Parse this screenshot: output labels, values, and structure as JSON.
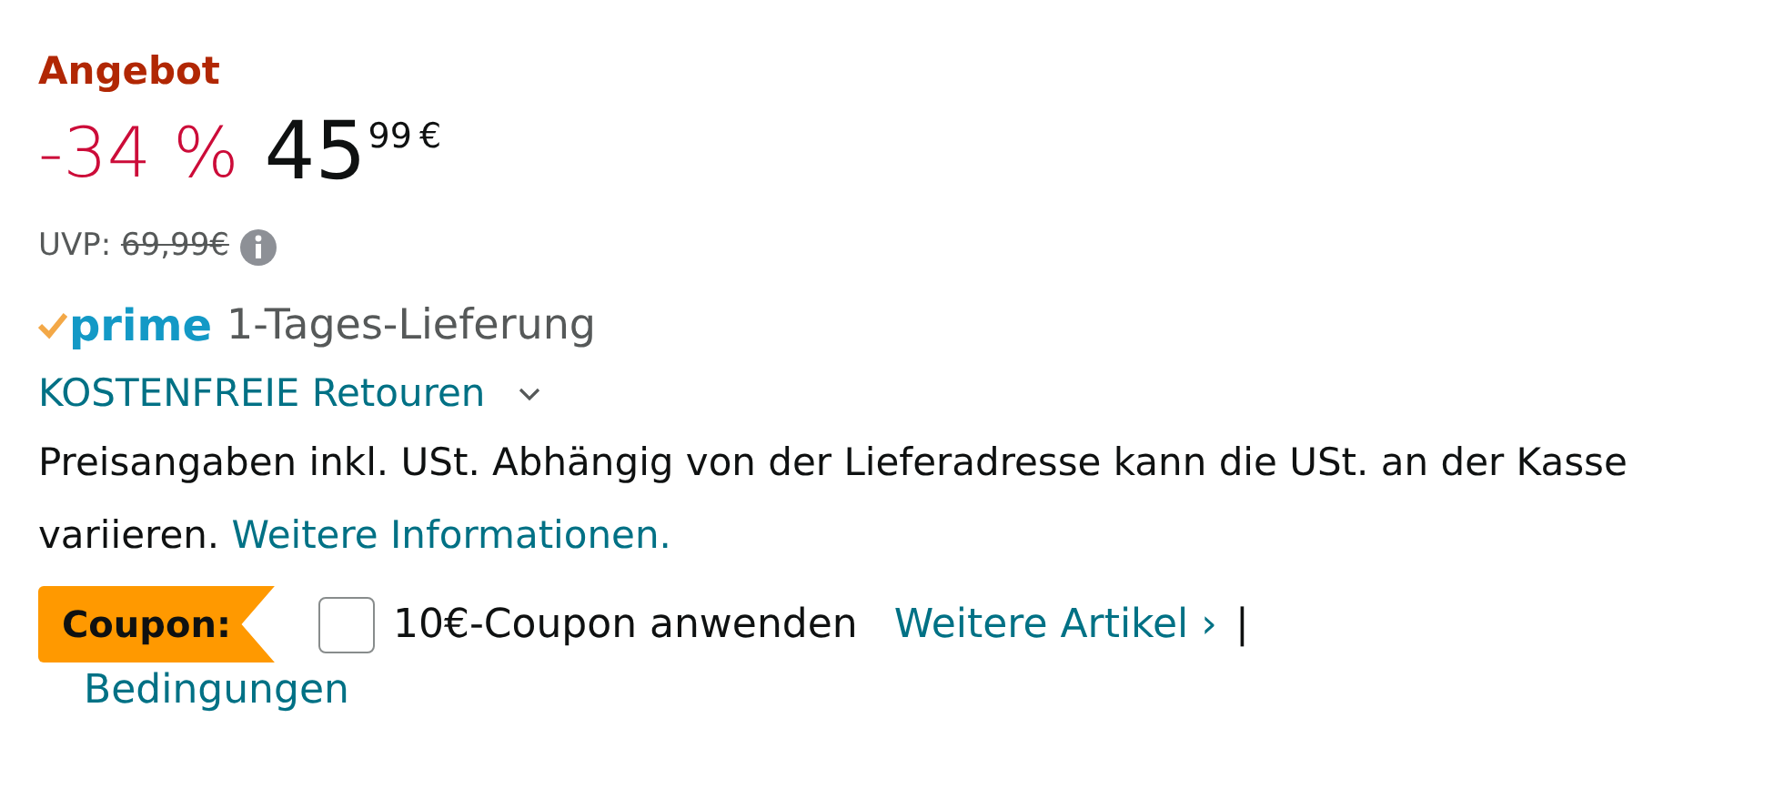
{
  "deal_label": "Angebot",
  "price": {
    "discount": "-34 %",
    "whole": "45",
    "fraction": "99",
    "currency": "€"
  },
  "list_price": {
    "label": "UVP:",
    "value": "69,99€"
  },
  "delivery": {
    "brand": "prime",
    "text": "1-Tages-Lieferung"
  },
  "returns": {
    "label": "KOSTENFREIE Retouren",
    "expanded": false
  },
  "tax_note": {
    "text": "Preisangaben inkl. USt. Abhängig von der Lieferadresse kann die USt. an der Kasse variieren.",
    "link": "Weitere Informationen."
  },
  "coupon": {
    "badge": "Coupon:",
    "checked": false,
    "label": "10€-Coupon anwenden",
    "more_link": "Weitere Artikel ›",
    "separator": "|",
    "terms_link": "Bedingungen"
  }
}
